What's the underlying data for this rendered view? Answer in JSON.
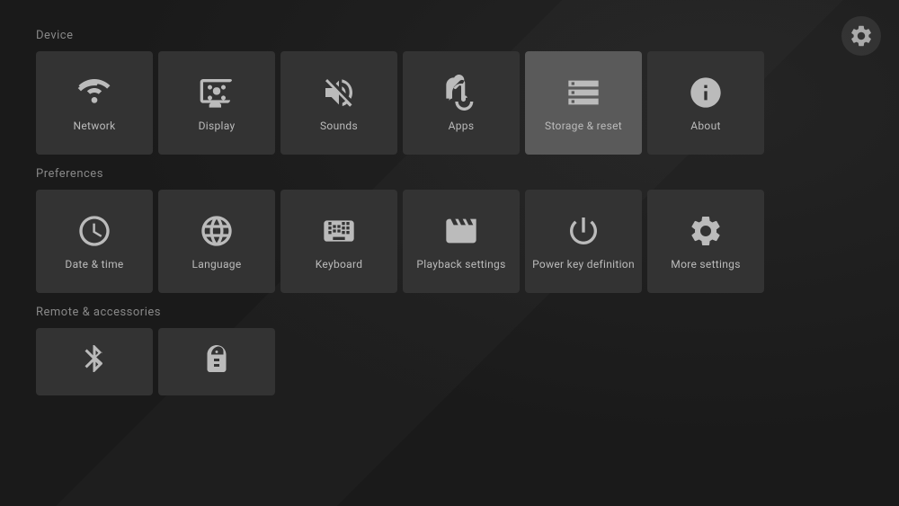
{
  "gear": {
    "label": "Settings"
  },
  "sections": {
    "device": {
      "label": "Device",
      "tiles": [
        {
          "id": "network",
          "label": "Network",
          "icon": "network"
        },
        {
          "id": "display",
          "label": "Display",
          "icon": "display"
        },
        {
          "id": "sounds",
          "label": "Sounds",
          "icon": "sounds"
        },
        {
          "id": "apps",
          "label": "Apps",
          "icon": "apps"
        },
        {
          "id": "storage",
          "label": "Storage & reset",
          "icon": "storage",
          "active": true
        },
        {
          "id": "about",
          "label": "About",
          "icon": "about"
        }
      ]
    },
    "preferences": {
      "label": "Preferences",
      "tiles": [
        {
          "id": "datetime",
          "label": "Date & time",
          "icon": "datetime"
        },
        {
          "id": "language",
          "label": "Language",
          "icon": "language"
        },
        {
          "id": "keyboard",
          "label": "Keyboard",
          "icon": "keyboard"
        },
        {
          "id": "playback",
          "label": "Playback settings",
          "icon": "playback"
        },
        {
          "id": "powerkey",
          "label": "Power key definition",
          "icon": "powerkey"
        },
        {
          "id": "more",
          "label": "More settings",
          "icon": "more"
        }
      ]
    },
    "remote": {
      "label": "Remote & accessories",
      "tiles": [
        {
          "id": "bluetooth",
          "label": "",
          "icon": "bluetooth"
        },
        {
          "id": "remote",
          "label": "",
          "icon": "remote"
        }
      ]
    }
  }
}
